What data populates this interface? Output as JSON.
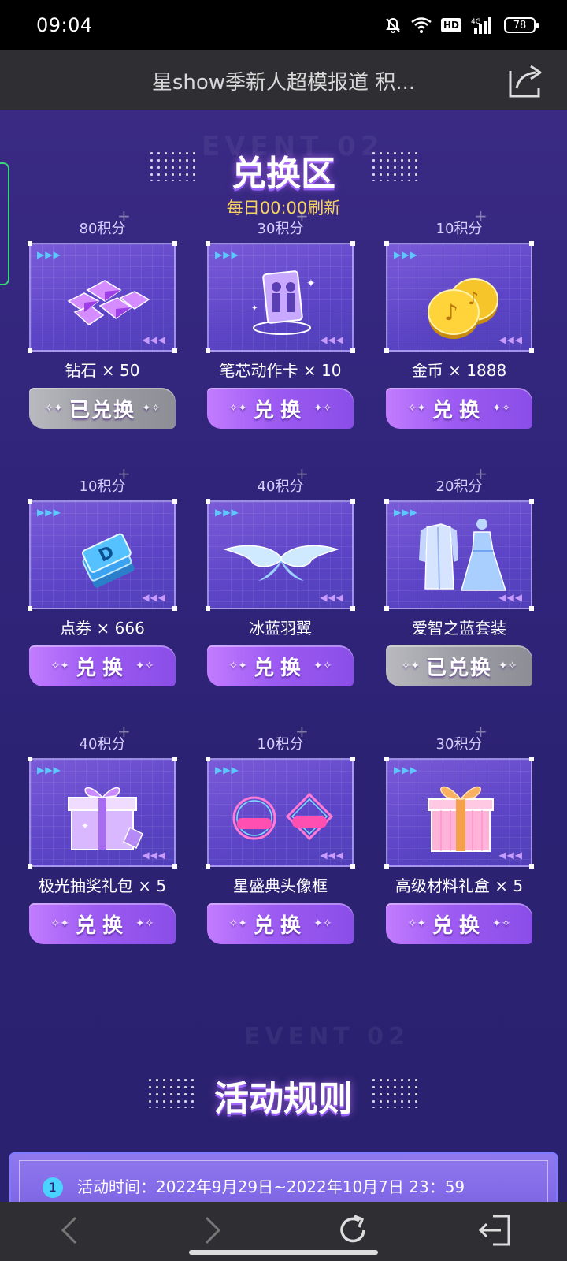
{
  "status_bar": {
    "time": "09:04",
    "hd": "HD",
    "network": "4G",
    "battery": "78",
    "icons": [
      "mute-icon",
      "wifi-icon",
      "hd-icon",
      "signal-icon",
      "battery-icon"
    ]
  },
  "title_bar": {
    "title": "星show季新人超模报道 积...",
    "share_icon": "share-icon"
  },
  "exchange": {
    "bg_label": "EVENT 02",
    "title": "兑换区",
    "refresh_note": "每日00:00刷新",
    "items": [
      {
        "cost": "80积分",
        "name": "钻石 × 50",
        "button": "已兑换",
        "state": "done",
        "icon": "diamond-icon"
      },
      {
        "cost": "30积分",
        "name": "笔芯动作卡 × 10",
        "button": "兑换",
        "state": "active",
        "icon": "action-card-icon"
      },
      {
        "cost": "10积分",
        "name": "金币 × 1888",
        "button": "兑换",
        "state": "active",
        "icon": "coin-icon"
      },
      {
        "cost": "10积分",
        "name": "点券 × 666",
        "button": "兑换",
        "state": "active",
        "icon": "voucher-icon"
      },
      {
        "cost": "40积分",
        "name": "冰蓝羽翼",
        "button": "兑换",
        "state": "active",
        "icon": "wings-icon"
      },
      {
        "cost": "20积分",
        "name": "爱智之蓝套装",
        "button": "已兑换",
        "state": "done",
        "icon": "outfit-icon"
      },
      {
        "cost": "40积分",
        "name": "极光抽奖礼包 × 5",
        "button": "兑换",
        "state": "active",
        "icon": "gift-pack-icon"
      },
      {
        "cost": "10积分",
        "name": "星盛典头像框",
        "button": "兑换",
        "state": "active",
        "icon": "avatar-frame-icon"
      },
      {
        "cost": "30积分",
        "name": "高级材料礼盒 × 5",
        "button": "兑换",
        "state": "active",
        "icon": "gift-box-icon"
      }
    ]
  },
  "rules": {
    "bg_label": "EVENT 02",
    "title": "活动规则",
    "items": [
      {
        "num": "1",
        "text": "活动时间：2022年9月29日~2022年10月7日 23：59"
      }
    ]
  },
  "colors": {
    "accent": "#9d5bf2",
    "done": "#9d9da5",
    "note": "#f7d163",
    "background": "#30247a"
  }
}
